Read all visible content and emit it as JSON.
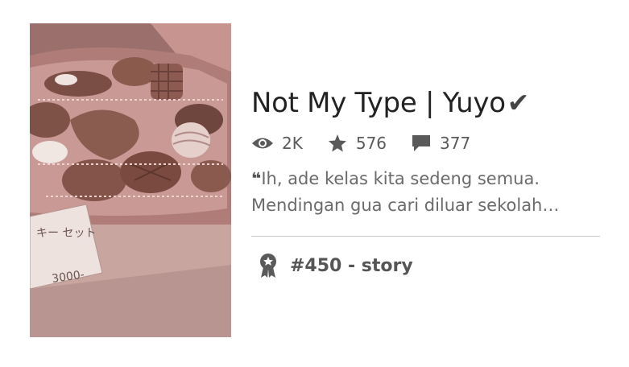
{
  "story": {
    "title": "Not My Type | Yuyo",
    "title_mark": "✔",
    "stats": {
      "reads": "2K",
      "votes": "576",
      "comments": "377"
    },
    "quote_mark": "❝",
    "description": "Ih, ade kelas kita sedeng semua. Mendingan gua cari diluar sekolah…",
    "rank": "#450 - story"
  },
  "cover": {
    "price_label": "3000-",
    "label_text": "キー セット"
  },
  "icons": {
    "reads": "eye-icon",
    "votes": "star-icon",
    "comments": "comment-icon",
    "rank": "ribbon-badge-icon"
  },
  "colors": {
    "title": "#222222",
    "meta": "#5a5a5a",
    "divider": "#c8c8c8"
  }
}
